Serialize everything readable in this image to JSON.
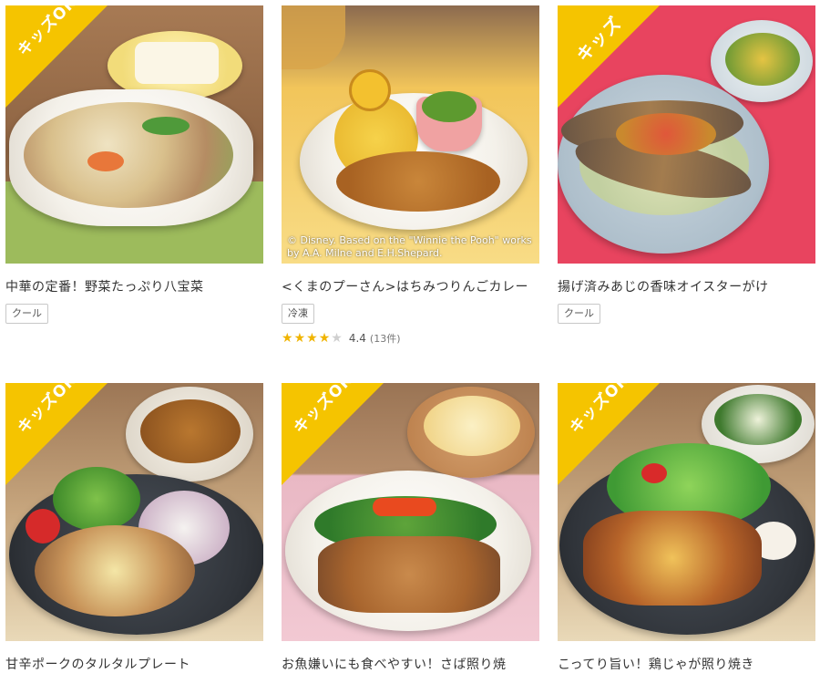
{
  "products": [
    {
      "title": "中華の定番！野菜たっぷり八宝菜",
      "badge": "キッズOK",
      "tag": "クール"
    },
    {
      "title": "<くまのプーさん>はちみつりんごカレー",
      "badge": "",
      "tag": "冷凍",
      "copyright": "© Disney. Based on the \"Winnie the Pooh\" works by A.A. Milne and E.H.Shepard.",
      "rating": {
        "score": "4.4",
        "count": "(13件)",
        "stars": 4
      }
    },
    {
      "title": "揚げ済みあじの香味オイスターがけ",
      "badge": "キッズ",
      "tag": "クール"
    },
    {
      "title": "甘辛ポークのタルタルプレート",
      "badge": "キッズOK"
    },
    {
      "title": "お魚嫌いにも食べやすい！さば照り焼",
      "badge": "キッズOK"
    },
    {
      "title": "こってり旨い！鶏じゃが照り焼き",
      "badge": "キッズOK"
    }
  ]
}
